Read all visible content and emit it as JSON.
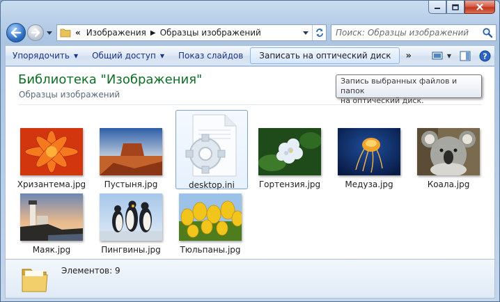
{
  "address": {
    "overflow": "«",
    "crumbs": [
      "Изображения",
      "Образцы изображений"
    ]
  },
  "search": {
    "placeholder": "Поиск: Образцы изображений"
  },
  "toolbar": {
    "organize": "Упорядочить",
    "share": "Общий доступ",
    "slideshow": "Показ слайдов",
    "burn": "Записать на оптический диск",
    "more": "»"
  },
  "library": {
    "title": "Библиотека \"Изображения\"",
    "subtitle": "Образцы изображений"
  },
  "tooltip": {
    "line1": "Запись выбранных файлов и папок",
    "line2": "на оптический диск."
  },
  "files": [
    {
      "name": "Хризантема.jpg"
    },
    {
      "name": "Пустыня.jpg"
    },
    {
      "name": "desktop.ini"
    },
    {
      "name": "Гортензия.jpg"
    },
    {
      "name": "Медуза.jpg"
    },
    {
      "name": "Коала.jpg"
    },
    {
      "name": "Маяк.jpg"
    },
    {
      "name": "Пингвины.jpg"
    },
    {
      "name": "Тюльпаны.jpg"
    }
  ],
  "status": {
    "items": "Элементов: 9"
  }
}
